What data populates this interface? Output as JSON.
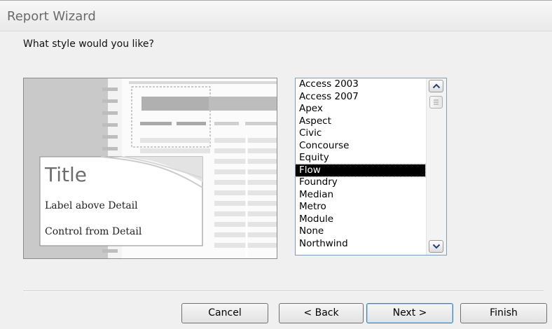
{
  "window": {
    "title": "Report Wizard"
  },
  "prompt": "What style would you like?",
  "preview": {
    "title": "Title",
    "label_text": "Label above Detail",
    "control_text": "Control from Detail"
  },
  "styles": {
    "items": [
      "Access 2003",
      "Access 2007",
      "Apex",
      "Aspect",
      "Civic",
      "Concourse",
      "Equity",
      "Flow",
      "Foundry",
      "Median",
      "Metro",
      "Module",
      "None",
      "Northwind"
    ],
    "selected": "Flow"
  },
  "buttons": {
    "cancel": "Cancel",
    "back": "< Back",
    "next": "Next >",
    "finish": "Finish"
  },
  "colors": {
    "selection": "#000000",
    "default_button_border": "#3c7fb1"
  },
  "icons": {
    "scroll_up": "chevron-up-icon",
    "scroll_down": "chevron-down-icon"
  }
}
